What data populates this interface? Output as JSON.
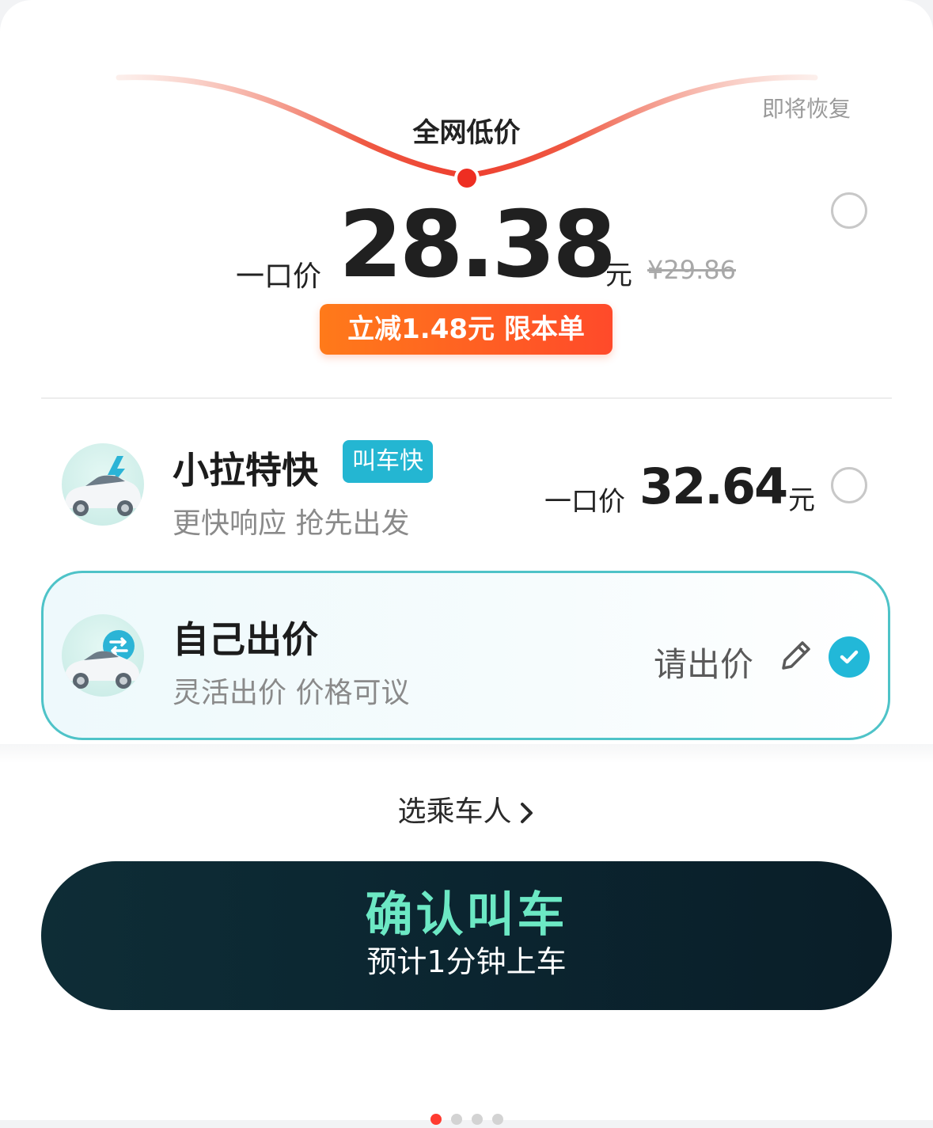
{
  "promo": {
    "title": "全网低价",
    "restore_note": "即将恢复",
    "price_prefix": "一口价",
    "price": "28.38",
    "unit": "元",
    "original_price": "¥29.86",
    "discount_badge": "立减1.48元 限本单"
  },
  "options": [
    {
      "title": "小拉特快",
      "tag": "叫车快",
      "subtitle": "更快响应 抢先出发",
      "price_prefix": "一口价",
      "price": "32.64",
      "unit": "元",
      "selected": false
    },
    {
      "title": "自己出价",
      "subtitle": "灵活出价 价格可议",
      "bid_text": "请出价",
      "selected": true
    }
  ],
  "passenger_label": "选乘车人",
  "confirm": {
    "title": "确认叫车",
    "subtitle": "预计1分钟上车"
  },
  "colors": {
    "accent_teal": "#24b6d2",
    "confirm_green": "#6ce8c4",
    "discount_orange": "#ff6a22",
    "curve_red": "#ee3e2e"
  }
}
